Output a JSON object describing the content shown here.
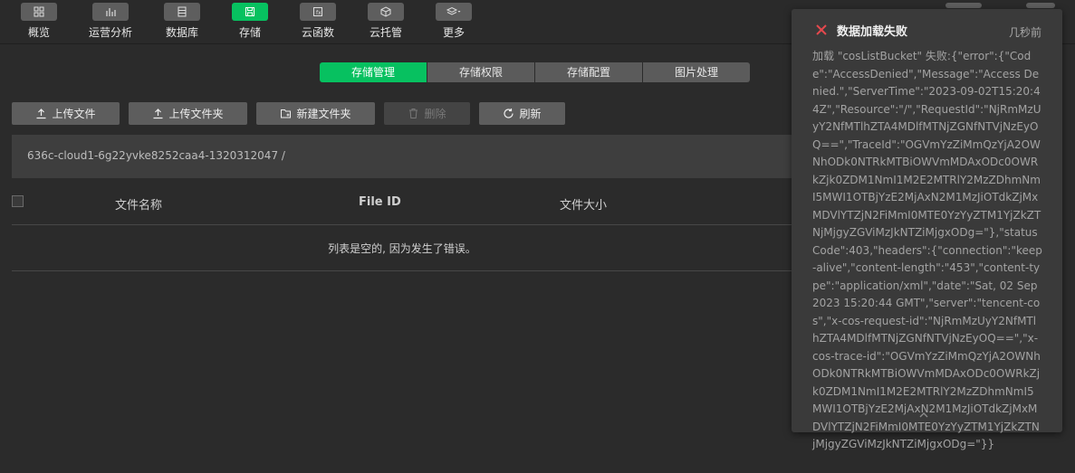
{
  "nav": {
    "items": [
      {
        "label": "概览",
        "icon": "dashboard-icon"
      },
      {
        "label": "运营分析",
        "icon": "bar-chart-icon"
      },
      {
        "label": "数据库",
        "icon": "database-icon"
      },
      {
        "label": "存储",
        "icon": "storage-icon",
        "active": true
      },
      {
        "label": "云函数",
        "icon": "function-icon"
      },
      {
        "label": "云托管",
        "icon": "cube-icon"
      },
      {
        "label": "更多",
        "icon": "layers-icon"
      }
    ]
  },
  "tabs": [
    {
      "label": "存储管理",
      "active": true
    },
    {
      "label": "存储权限"
    },
    {
      "label": "存储配置"
    },
    {
      "label": "图片处理"
    }
  ],
  "actions": {
    "upload_file": "上传文件",
    "upload_folder": "上传文件夹",
    "new_folder": "新建文件夹",
    "delete": "删除",
    "refresh": "刷新"
  },
  "path": {
    "bucket": "636c-cloud1-6g22yvke8252caa4-1320312047  /"
  },
  "table": {
    "columns": [
      "文件名称",
      "File ID",
      "文件大小"
    ],
    "empty_text": "列表是空的, 因为发生了错误。"
  },
  "notification": {
    "title": "数据加载失败",
    "time": "几秒前",
    "message": "加载 \"cosListBucket\" 失败:{\"error\":{\"Code\":\"AccessDenied\",\"Message\":\"Access Denied.\",\"ServerTime\":\"2023-09-02T15:20:44Z\",\"Resource\":\"/\",\"RequestId\":\"NjRmMzUyY2NfMTlhZTA4MDlfMTNjZGNfNTVjNzEyOQ==\",\"TraceId\":\"OGVmYzZiMmQzYjA2OWNhODk0NTRkMTBiOWVmMDAxODc0OWRkZjk0ZDM1NmI1M2E2MTRlY2MzZDhmNmI5MWI1OTBjYzE2MjAxN2M1MzJiOTdkZjMxMDVlYTZjN2FiMmI0MTE0YzYyZTM1YjZkZTNjMjgyZGViMzJkNTZiMjgxODg=\"},\"statusCode\":403,\"headers\":{\"connection\":\"keep-alive\",\"content-length\":\"453\",\"content-type\":\"application/xml\",\"date\":\"Sat, 02 Sep 2023 15:20:44 GMT\",\"server\":\"tencent-cos\",\"x-cos-request-id\":\"NjRmMzUyY2NfMTlhZTA4MDlfMTNjZGNfNTVjNzEyOQ==\",\"x-cos-trace-id\":\"OGVmYzZiMmQzYjA2OWNhODk0NTRkMTBiOWVmMDAxODc0OWRkZjk0ZDM1NmI1M2E2MTRlY2MzZDhmNmI5MWI1OTBjYzE2MjAxN2M1MzJiOTdkZjMxMDVlYTZjN2FiMmI0MTE0YzYyZTM1YjZkZTNjMjgyZGViMzJkNTZiMjgxODg=\"}}"
  },
  "colors": {
    "accent": "#07c160",
    "error": "#e5484d"
  }
}
